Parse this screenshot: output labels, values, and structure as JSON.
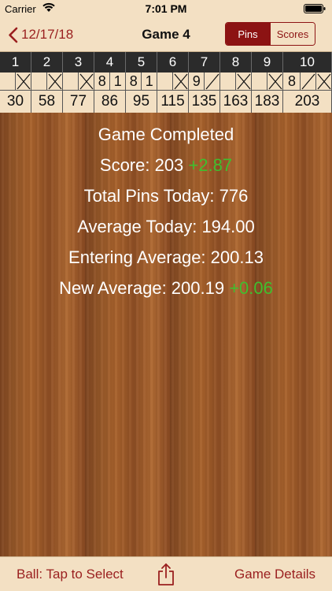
{
  "status_bar": {
    "carrier": "Carrier",
    "time": "7:01 PM"
  },
  "nav": {
    "back_label": "12/17/18",
    "title": "Game 4",
    "segments": [
      "Pins",
      "Scores"
    ],
    "selected_segment": "Pins"
  },
  "score_sheet": {
    "frames": [
      {
        "number": "1",
        "marks": [
          "",
          "X"
        ],
        "total": "30"
      },
      {
        "number": "2",
        "marks": [
          "",
          "X"
        ],
        "total": "58"
      },
      {
        "number": "3",
        "marks": [
          "",
          "X"
        ],
        "total": "77"
      },
      {
        "number": "4",
        "marks": [
          "8",
          "1"
        ],
        "total": "86"
      },
      {
        "number": "5",
        "marks": [
          "8",
          "1"
        ],
        "total": "95"
      },
      {
        "number": "6",
        "marks": [
          "",
          "X"
        ],
        "total": "115"
      },
      {
        "number": "7",
        "marks": [
          "9",
          "/"
        ],
        "total": "135"
      },
      {
        "number": "8",
        "marks": [
          "",
          "X"
        ],
        "total": "163"
      },
      {
        "number": "9",
        "marks": [
          "",
          "X"
        ],
        "total": "183"
      },
      {
        "number": "10",
        "marks": [
          "8",
          "/",
          "X"
        ],
        "total": "203"
      }
    ]
  },
  "summary": {
    "title": "Game Completed",
    "score_label": "Score: 203",
    "score_delta": "+2.87",
    "total_pins": "Total Pins Today: 776",
    "average_today": "Average Today: 194.00",
    "entering_average": "Entering Average: 200.13",
    "new_average_label": "New Average: 200.19",
    "new_average_delta": "+0.06"
  },
  "toolbar": {
    "left_label": "Ball: Tap to Select",
    "share_icon": "share-icon",
    "right_label": "Game Details"
  },
  "colors": {
    "accent": "#9a1f1f",
    "panel": "#f3e0c3",
    "delta_green": "#3fbf2e",
    "header_dark": "#2b2b2b"
  }
}
